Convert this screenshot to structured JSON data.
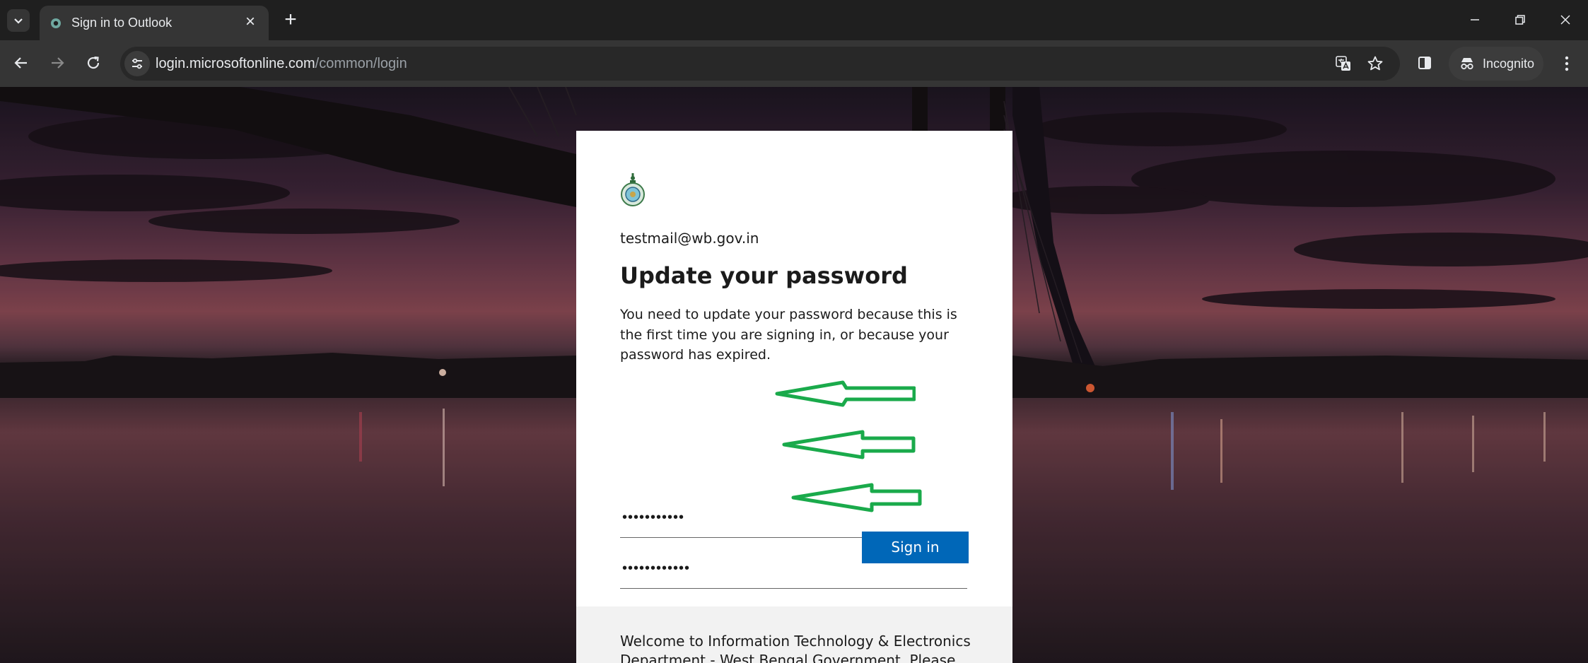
{
  "browser": {
    "tab": {
      "title": "Sign in to Outlook"
    },
    "address": {
      "host": "login.microsoftonline.com",
      "path": "/common/login"
    },
    "profile": {
      "label": "Incognito"
    }
  },
  "colors": {
    "accent": "#0067b8",
    "annotation_arrow": "#1aaa4b",
    "card_bg": "#ffffff",
    "footer_bg": "#f2f2f2"
  },
  "signin": {
    "account": "testmail@wb.gov.in",
    "heading": "Update your password",
    "description": "You need to update your password because this is the first time you are signing in, or because your password has expired.",
    "fields": [
      {
        "name": "current-password",
        "masked_value": "•••••••••••"
      },
      {
        "name": "new-password",
        "masked_value": "••••••••••••"
      },
      {
        "name": "confirm-password",
        "masked_value": "••••••••••••"
      }
    ],
    "button": "Sign in",
    "footer": "Welcome to Information Technology & Electronics Department - West Bengal Government. Please sign"
  }
}
